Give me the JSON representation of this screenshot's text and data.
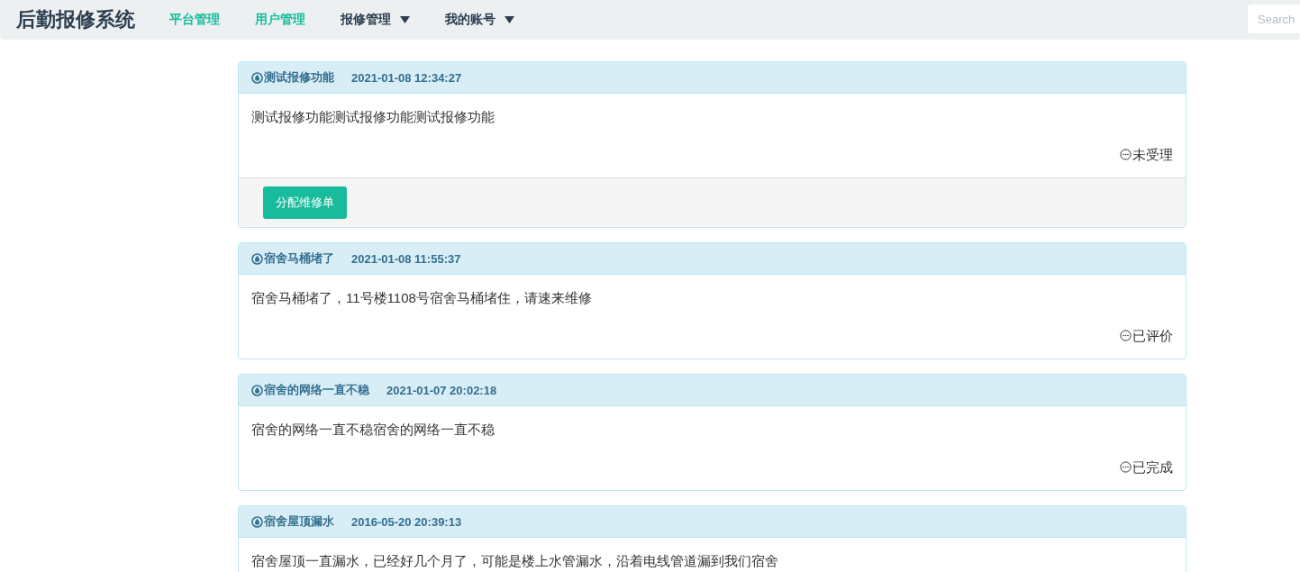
{
  "navbar": {
    "brand": "后勤报修系统",
    "items": [
      {
        "label": "平台管理",
        "kind": "link"
      },
      {
        "label": "用户管理",
        "kind": "link"
      },
      {
        "label": "报修管理",
        "kind": "dropdown"
      },
      {
        "label": "我的账号",
        "kind": "dropdown"
      }
    ],
    "search": {
      "placeholder": "Search"
    }
  },
  "reports": [
    {
      "title": "测试报修功能",
      "time": "2021-01-08 12:34:27",
      "body": "测试报修功能测试报修功能测试报修功能",
      "status": "未受理",
      "actions": [
        "分配维修单"
      ]
    },
    {
      "title": "宿舍马桶堵了",
      "time": "2021-01-08 11:55:37",
      "body": "宿舍马桶堵了，11号楼1108号宿舍马桶堵住，请速来维修",
      "status": "已评价"
    },
    {
      "title": "宿舍的网络一直不稳",
      "time": "2021-01-07 20:02:18",
      "body": "宿舍的网络一直不稳宿舍的网络一直不稳",
      "status": "已完成"
    },
    {
      "title": "宿舍屋顶漏水",
      "time": "2016-05-20 20:39:13",
      "body": "宿舍屋顶一直漏水，已经好几个月了，可能是楼上水管漏水，沿着电线管道漏到我们宿舍"
    }
  ]
}
